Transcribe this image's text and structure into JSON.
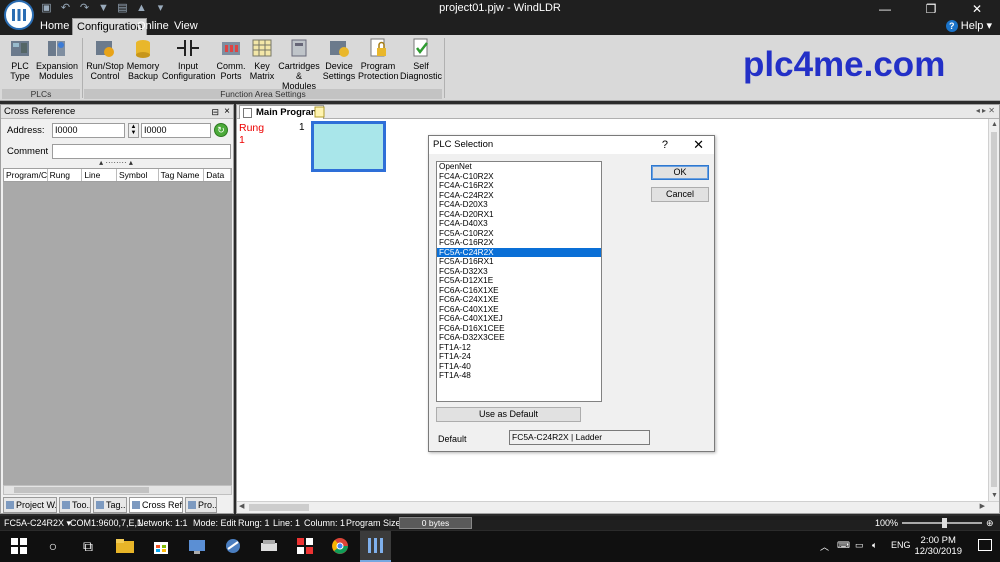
{
  "window": {
    "title": "project01.pjw - WindLDR",
    "minimize": "—",
    "restore": "❐",
    "close": "✕"
  },
  "menu": {
    "tabs": [
      "Home",
      "Configuration",
      "Online",
      "View"
    ],
    "active": "Configuration",
    "help": "Help"
  },
  "ribbon": {
    "groups": [
      {
        "label": "PLCs",
        "buttons": [
          {
            "line1": "PLC",
            "line2": "Type",
            "icon": "plc-type-icon"
          },
          {
            "line1": "Expansion",
            "line2": "Modules",
            "icon": "expansion-modules-icon"
          }
        ]
      },
      {
        "label": "Function Area Settings",
        "buttons": [
          {
            "line1": "Run/Stop",
            "line2": "Control",
            "icon": "run-stop-icon"
          },
          {
            "line1": "Memory",
            "line2": "Backup",
            "icon": "memory-backup-icon"
          },
          {
            "line1": "Input",
            "line2": "Configuration",
            "icon": "input-configuration-icon"
          },
          {
            "line1": "Comm.",
            "line2": "Ports",
            "icon": "comm-ports-icon"
          },
          {
            "line1": "Key",
            "line2": "Matrix",
            "icon": "key-matrix-icon"
          },
          {
            "line1": "Cartridges",
            "line2": "& Modules",
            "icon": "cartridges-icon"
          },
          {
            "line1": "Device",
            "line2": "Settings",
            "icon": "device-settings-icon"
          },
          {
            "line1": "Program",
            "line2": "Protection",
            "icon": "program-protection-icon"
          },
          {
            "line1": "Self",
            "line2": "Diagnostic",
            "icon": "self-diagnostic-icon"
          }
        ]
      }
    ],
    "watermark": "plc4me.com"
  },
  "cross_reference": {
    "title": "Cross Reference",
    "address_label": "Address:",
    "address_from": "I0000",
    "address_to": "I0000",
    "comment_label": "Comment",
    "comment_value": "",
    "columns": [
      "Program/C",
      "Rung",
      "Line",
      "Symbol",
      "Tag Name",
      "Data"
    ],
    "bottom_tabs": [
      "Project W..",
      "Too..",
      "Tag..",
      "Cross Ref..",
      "Pro.."
    ],
    "active_bottom_tab": "Cross Ref.."
  },
  "editor": {
    "tab_label": "Main Program",
    "rung_label": "Rung",
    "rung_number": "1",
    "line_number": "1"
  },
  "dialog": {
    "title": "PLC Selection",
    "help_glyph": "?",
    "close_glyph": "✕",
    "items": [
      "OpenNet",
      "FC4A-C10R2X",
      "FC4A-C16R2X",
      "FC4A-C24R2X",
      "FC4A-D20X3",
      "FC4A-D20RX1",
      "FC4A-D40X3",
      "FC5A-C10R2X",
      "FC5A-C16R2X",
      "FC5A-C24R2X",
      "FC5A-D16RX1",
      "FC5A-D32X3",
      "FC5A-D12X1E",
      "FC6A-C16X1XE",
      "FC6A-C24X1XE",
      "FC6A-C40X1XE",
      "FC6A-C40X1XEJ",
      "FC6A-D16X1CEE",
      "FC6A-D32X3CEE",
      "FT1A-12",
      "FT1A-24",
      "FT1A-40",
      "FT1A-48"
    ],
    "selected": "FC5A-C24R2X",
    "ok_label": "OK",
    "cancel_label": "Cancel",
    "use_default_label": "Use as Default",
    "default_label": "Default",
    "default_value": "FC5A-C24R2X | Ladder"
  },
  "status": {
    "plc": "FC5A-C24R2X ▾",
    "comm": "COM1:9600,7,E,1",
    "network": "Network: 1:1",
    "mode": "Mode: Edit",
    "rung": "Rung: 1",
    "line": "Line: 1",
    "column": "Column: 1",
    "program_size_label": "Program Size:",
    "program_size_value": "0 bytes",
    "zoom": "100%",
    "zoom_level": 100
  },
  "taskbar": {
    "language": "ENG",
    "time": "2:00 PM",
    "date": "12/30/2019"
  }
}
